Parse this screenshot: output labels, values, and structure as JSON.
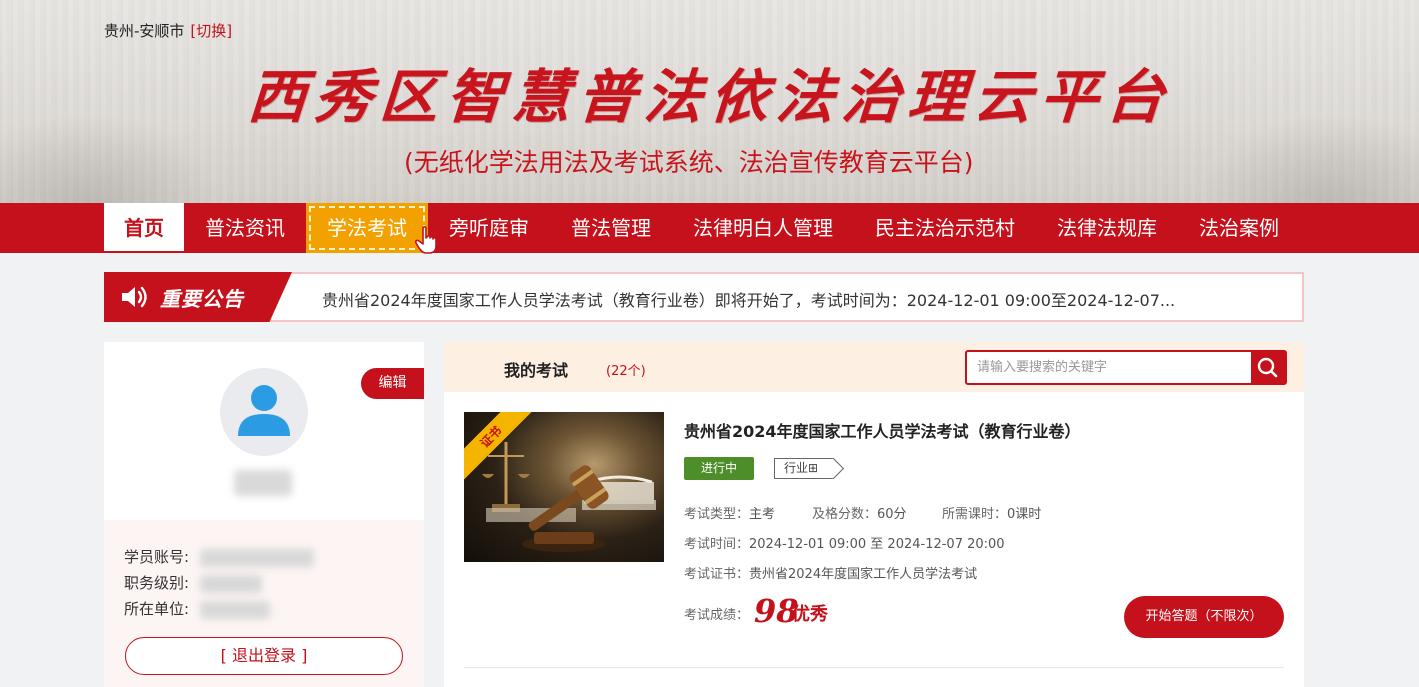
{
  "header": {
    "location": "贵州-安顺市",
    "switch_label": "[切换]",
    "site_title": "西秀区智慧普法依法治理云平台",
    "site_subtitle": "(无纸化学法用法及考试系统、法治宣传教育云平台)"
  },
  "nav": {
    "items": [
      {
        "label": "首页",
        "state": "active"
      },
      {
        "label": "普法资讯"
      },
      {
        "label": "学法考试",
        "state": "hover"
      },
      {
        "label": "旁听庭审"
      },
      {
        "label": "普法管理"
      },
      {
        "label": "法律明白人管理"
      },
      {
        "label": "民主法治示范村"
      },
      {
        "label": "法律法规库"
      },
      {
        "label": "法治案例"
      }
    ]
  },
  "notice": {
    "label": "重要公告",
    "icon": "speaker-icon",
    "text": "贵州省2024年度国家工作人员学法考试（教育行业卷）即将开始了，考试时间为：2024-12-01 09:00至2024-12-07..."
  },
  "profile": {
    "edit_label": "编辑",
    "account_label": "学员账号:",
    "level_label": "职务级别:",
    "unit_label": "所在单位:",
    "logout_label": "[ 退出登录 ]"
  },
  "exams": {
    "title": "我的考试",
    "count": "(22个)",
    "search_placeholder": "请输入要搜索的关键字",
    "items": [
      {
        "ribbon": "证书",
        "title": "贵州省2024年度国家工作人员学法考试（教育行业卷）",
        "status": "进行中",
        "tag": "行业⊞",
        "type_label": "考试类型：",
        "type_value": "主考",
        "pass_label": "及格分数：",
        "pass_value": "60分",
        "hours_label": "所需课时：",
        "hours_value": "0课时",
        "time_label": "考试时间：",
        "time_value": "2024-12-01 09:00 至 2024-12-07 20:00",
        "cert_label": "考试证书：",
        "cert_value": "贵州省2024年度国家工作人员学法考试",
        "score_label": "考试成绩：",
        "score": "98",
        "grade": "优秀",
        "start_label": "开始答题（不限次）"
      }
    ]
  },
  "colors": {
    "brand_red": "#c4111b",
    "hover_orange": "#f3a100",
    "status_green": "#4d8e2a"
  }
}
